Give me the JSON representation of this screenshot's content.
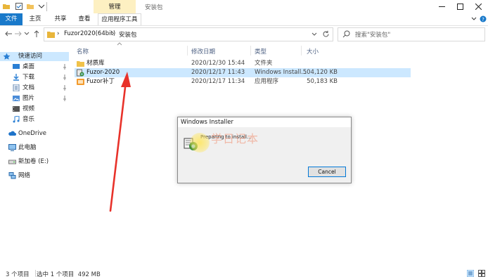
{
  "window": {
    "title": "安装包",
    "context_tab_group": "管理",
    "minimize_label": "—",
    "maximize_label": "☐",
    "close_label": "✕"
  },
  "ribbon": {
    "tabs": [
      {
        "label": "文件"
      },
      {
        "label": "主页"
      },
      {
        "label": "共享"
      },
      {
        "label": "查看"
      },
      {
        "label": "应用程序工具"
      }
    ]
  },
  "address": {
    "path": [
      "Fuzor2020(64bit)",
      "安装包"
    ],
    "search_placeholder": "搜索\"安装包\""
  },
  "navpane": {
    "items": [
      {
        "label": "快速访问",
        "icon": "star-icon",
        "pinned": false
      },
      {
        "label": "桌面",
        "icon": "desktop-icon",
        "pinned": true
      },
      {
        "label": "下载",
        "icon": "download-icon",
        "pinned": true
      },
      {
        "label": "文档",
        "icon": "document-icon",
        "pinned": true
      },
      {
        "label": "图片",
        "icon": "pictures-icon",
        "pinned": true
      },
      {
        "label": "视频",
        "icon": "video-icon",
        "pinned": false
      },
      {
        "label": "音乐",
        "icon": "music-icon",
        "pinned": false
      },
      {
        "label": "OneDrive",
        "icon": "cloud-icon",
        "pinned": false
      },
      {
        "label": "此电脑",
        "icon": "computer-icon",
        "pinned": false
      },
      {
        "label": "新加卷 (E:)",
        "icon": "drive-icon",
        "pinned": false
      },
      {
        "label": "网络",
        "icon": "network-icon",
        "pinned": false
      }
    ]
  },
  "files": {
    "columns": {
      "name": "名称",
      "date": "修改日期",
      "type": "类型",
      "size": "大小"
    },
    "rows": [
      {
        "name": "材质库",
        "date": "2020/12/30 15:44",
        "type": "文件夹",
        "size": "",
        "icon": "folder-icon"
      },
      {
        "name": "Fuzor-2020",
        "date": "2020/12/17 11:43",
        "type": "Windows Install...",
        "size": "504,120 KB",
        "icon": "msi-installer-icon"
      },
      {
        "name": "Fuzor补丁",
        "date": "2020/12/17 11:34",
        "type": "应用程序",
        "size": "50,183 KB",
        "icon": "application-icon"
      }
    ]
  },
  "status": {
    "item_count": "3 个项目",
    "selection": "选中 1 个项目  492 MB"
  },
  "dialog": {
    "title": "Windows Installer",
    "message": "Preparing to install...",
    "cancel_label": "Cancel"
  },
  "overlay": {
    "watermark": "学日记本"
  },
  "colors": {
    "accent": "#1979ca",
    "selection": "#cce8ff",
    "context_tab": "#fdf0c2",
    "arrow": "#e8322a"
  }
}
